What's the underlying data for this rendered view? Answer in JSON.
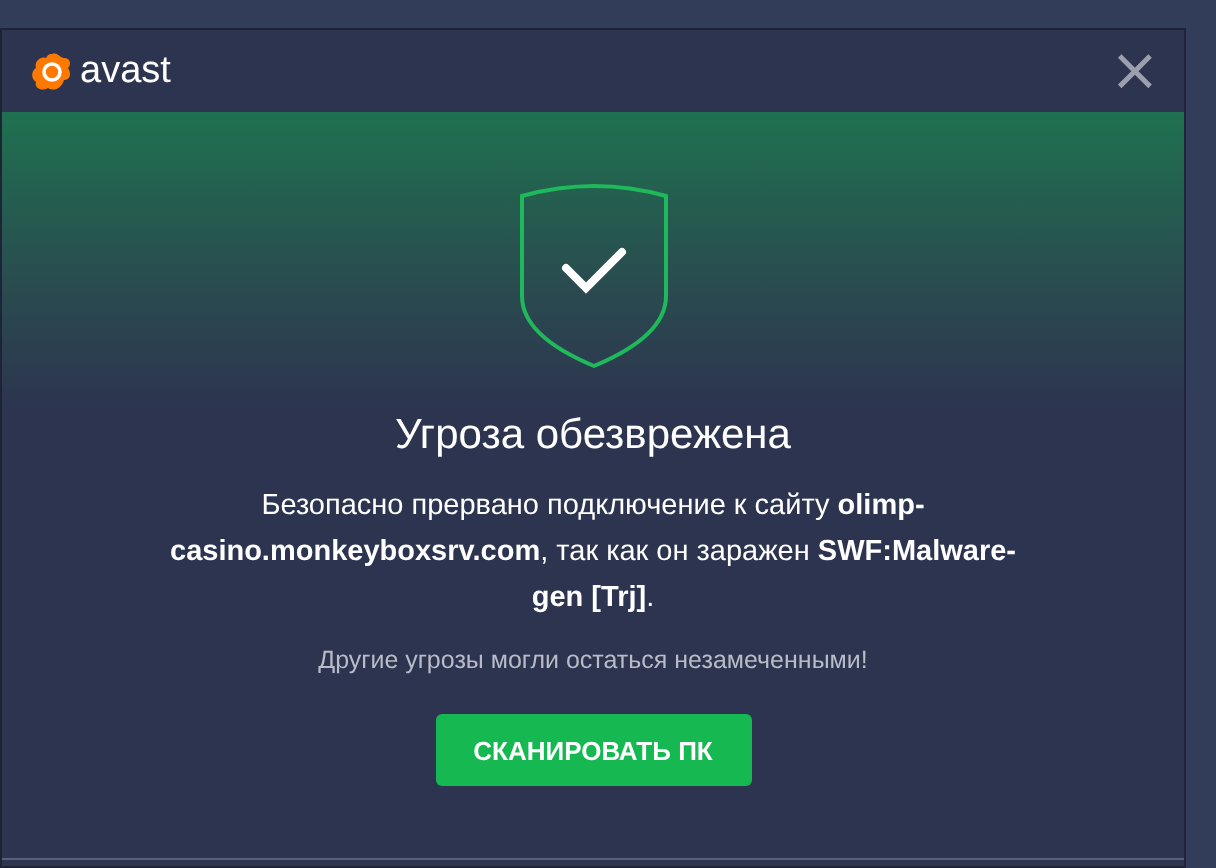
{
  "window": {
    "logo_text": "avast",
    "close": "×"
  },
  "alert": {
    "title": "Угроза обезврежена",
    "message": "Безопасно прервано подключение к сайту **olimp-casino.monkeyboxsrv.com**, так как он заражен **SWF:Malware-gen [Trj]**.",
    "note": "Другие угрозы могли остаться незамеченными!"
  },
  "buttons": [
    {
      "label": "СКАНИРОВАТЬ ПК",
      "kind": "primary"
    }
  ]
}
